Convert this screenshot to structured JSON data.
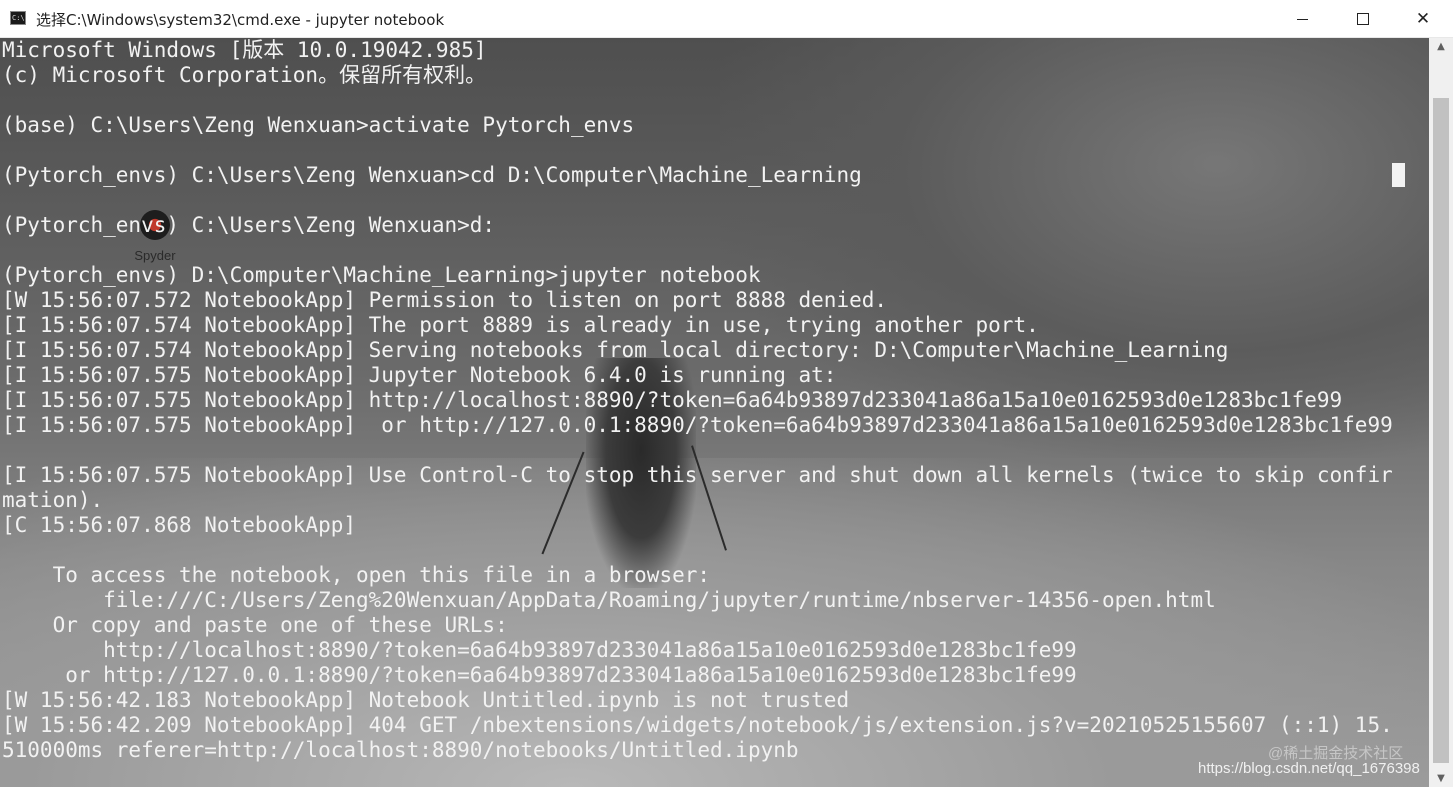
{
  "window": {
    "title": "选择C:\\Windows\\system32\\cmd.exe - jupyter  notebook",
    "icon": "cmd-icon",
    "controls": {
      "minimize": "minimize-icon",
      "maximize": "maximize-icon",
      "close": "✕"
    }
  },
  "desktop_icon": {
    "label": "Spyder"
  },
  "terminal": {
    "lines": [
      "Microsoft Windows [版本 10.0.19042.985]",
      "(c) Microsoft Corporation。保留所有权利。",
      "",
      "(base) C:\\Users\\Zeng Wenxuan>activate Pytorch_envs",
      "",
      "(Pytorch_envs) C:\\Users\\Zeng Wenxuan>cd D:\\Computer\\Machine_Learning",
      "",
      "(Pytorch_envs) C:\\Users\\Zeng Wenxuan>d:",
      "",
      "(Pytorch_envs) D:\\Computer\\Machine_Learning>jupyter notebook",
      "[W 15:56:07.572 NotebookApp] Permission to listen on port 8888 denied.",
      "[I 15:56:07.574 NotebookApp] The port 8889 is already in use, trying another port.",
      "[I 15:56:07.574 NotebookApp] Serving notebooks from local directory: D:\\Computer\\Machine_Learning",
      "[I 15:56:07.575 NotebookApp] Jupyter Notebook 6.4.0 is running at:",
      "[I 15:56:07.575 NotebookApp] http://localhost:8890/?token=6a64b93897d233041a86a15a10e0162593d0e1283bc1fe99",
      "[I 15:56:07.575 NotebookApp]  or http://127.0.0.1:8890/?token=6a64b93897d233041a86a15a10e0162593d0e1283bc1fe99",
      "",
      "[I 15:56:07.575 NotebookApp] Use Control-C to stop this server and shut down all kernels (twice to skip confir",
      "mation).",
      "[C 15:56:07.868 NotebookApp]",
      "",
      "    To access the notebook, open this file in a browser:",
      "        file:///C:/Users/Zeng%20Wenxuan/AppData/Roaming/jupyter/runtime/nbserver-14356-open.html",
      "    Or copy and paste one of these URLs:",
      "        http://localhost:8890/?token=6a64b93897d233041a86a15a10e0162593d0e1283bc1fe99",
      "     or http://127.0.0.1:8890/?token=6a64b93897d233041a86a15a10e0162593d0e1283bc1fe99",
      "[W 15:56:42.183 NotebookApp] Notebook Untitled.ipynb is not trusted",
      "[W 15:56:42.209 NotebookApp] 404 GET /nbextensions/widgets/notebook/js/extension.js?v=20210525155607 (::1) 15.",
      "510000ms referer=http://localhost:8890/notebooks/Untitled.ipynb"
    ]
  },
  "watermark": {
    "line1": "@稀土掘金技术社区",
    "line2": "https://blog.csdn.net/qq_1676398"
  },
  "scrollbar": {
    "up": "▲",
    "down": "▼"
  }
}
